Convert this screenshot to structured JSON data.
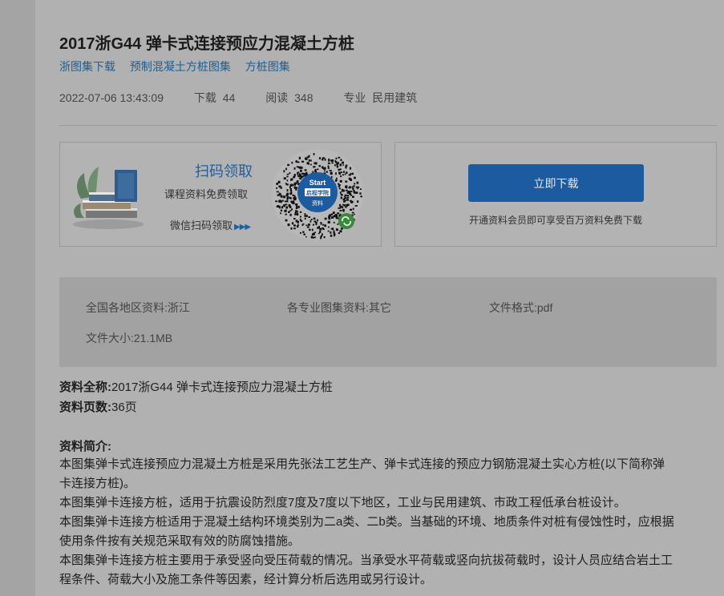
{
  "document": {
    "title": "2017浙G44 弹卡式连接预应力混凝土方桩",
    "tags": [
      "浙图集下载",
      "预制混凝土方桩图集",
      "方桩图集"
    ],
    "meta": {
      "datetime": "2022-07-06 13:43:09",
      "downloads_label": "下载",
      "downloads": "44",
      "reads_label": "阅读",
      "reads": "348",
      "major_label": "专业",
      "major": "民用建筑"
    }
  },
  "promo": {
    "scan_title": "扫码领取",
    "scan_subtitle": "课程资料免费领取",
    "scan_cta": "微信扫码领取",
    "scan_cta_arrows": "▶▶▶",
    "qr_badge_top": "Start",
    "qr_badge_mid": "启程学院",
    "qr_badge_bottom": "资料"
  },
  "download": {
    "button_label": "立即下载",
    "note": "开通资料会员即可享受百万资料免费下载"
  },
  "info": {
    "region": "全国各地区资料:浙江",
    "category": "各专业图集资料:其它",
    "format": "文件格式:pdf",
    "size": "文件大小:21.1MB"
  },
  "details": {
    "fullname_label": "资料全称:",
    "fullname": "2017浙G44 弹卡式连接预应力混凝土方桩",
    "pages_label": "资料页数:",
    "pages": "36页",
    "intro_label": "资料简介:",
    "intro_lines": [
      "本图集弹卡式连接预应力混凝土方桩是采用先张法工艺生产、弹卡式连接的预应力钢筋混凝土实心方桩(以下简称弹",
      "卡连接方桩)。",
      "本图集弹卡连接方桩，适用于抗震设防烈度7度及7度以下地区，工业与民用建筑、市政工程低承台桩设计。",
      "本图集弹卡连接方桩适用于混凝土结构环境类别为二a类、二b类。当基础的环境、地质条件对桩有侵蚀性时，应根据",
      "使用条件按有关规范采取有效的防腐蚀措施。",
      "本图集弹卡连接方桩主要用于承受竖向受压荷载的情况。当承受水平荷载或竖向抗拔荷载时，设计人员应结合岩土工",
      "程条件、荷载大小及施工条件等因素，经计算分析后选用或另行设计。"
    ]
  }
}
